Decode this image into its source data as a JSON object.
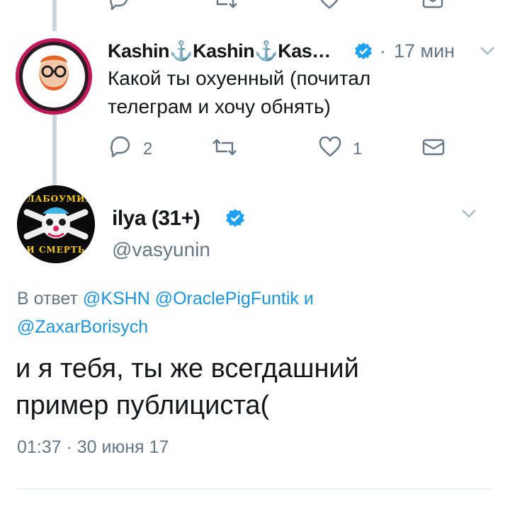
{
  "prev_tweet_actions": {
    "items": [
      "reply-icon",
      "retweet-icon",
      "like-icon",
      "dm-icon"
    ]
  },
  "tweet1": {
    "author_name": "Kashin⚓Kashin⚓Kas…",
    "verified": true,
    "separator": "·",
    "time": "17 мин",
    "text_line1": "Какой ты охуенный (почитал",
    "text_line2": "телеграм и хочу обнять)",
    "reply_count": "2",
    "retweet_count": "",
    "like_count": "1",
    "avatar": "bearded-man-with-glasses-avatar"
  },
  "tweet2": {
    "author_name": "ilya (31+)",
    "verified": true,
    "handle": "@vasyunin",
    "reply_prefix": "В ответ",
    "mention1": "@KSHN",
    "mention2": "@OraclePigFuntik",
    "and_word": "и",
    "mention3": "@ZaxarBorisych",
    "text_line1": "и я тебя, ты же всегдашний",
    "text_line2": "пример публициста(",
    "timestamp": "01:37 · 30 июня 17",
    "avatar": "clown-skull-avatar",
    "avatar_text_top": "СЛАБОУМИЕ",
    "avatar_text_bottom": "И СМЕРТЬ"
  },
  "colors": {
    "link": "#1b95e0",
    "verified": "#1da1f2",
    "muted": "#657786",
    "thread_line": "#ccd6dd"
  }
}
